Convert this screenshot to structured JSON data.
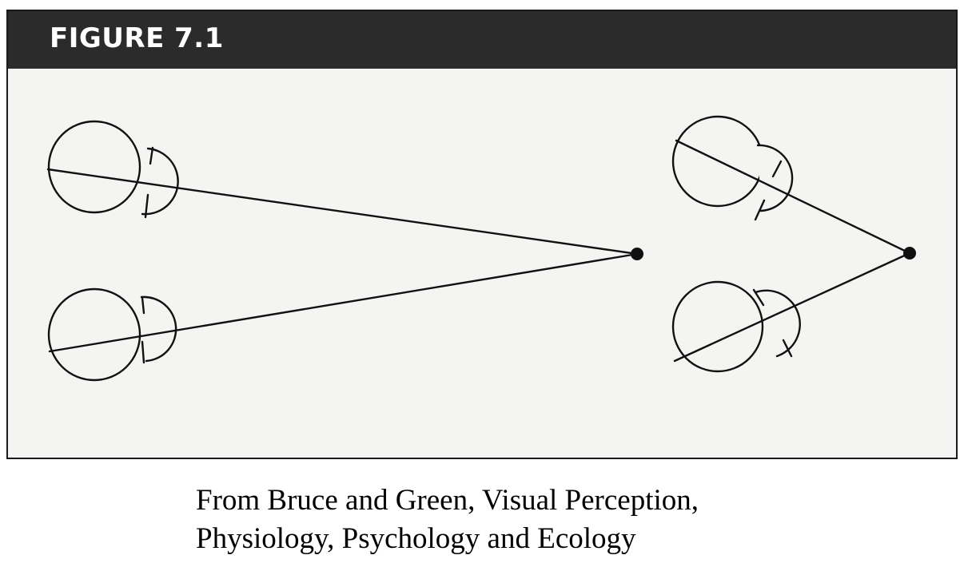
{
  "figure": {
    "title": "FIGURE 7.1"
  },
  "caption": {
    "line1": "From Bruce and Green, Visual Perception,",
    "line2": "Physiology, Psychology and Ecology"
  },
  "colors": {
    "header_background": "#2b2b2b",
    "panel_background": "#f4f4f2",
    "ink": "#111111"
  }
}
